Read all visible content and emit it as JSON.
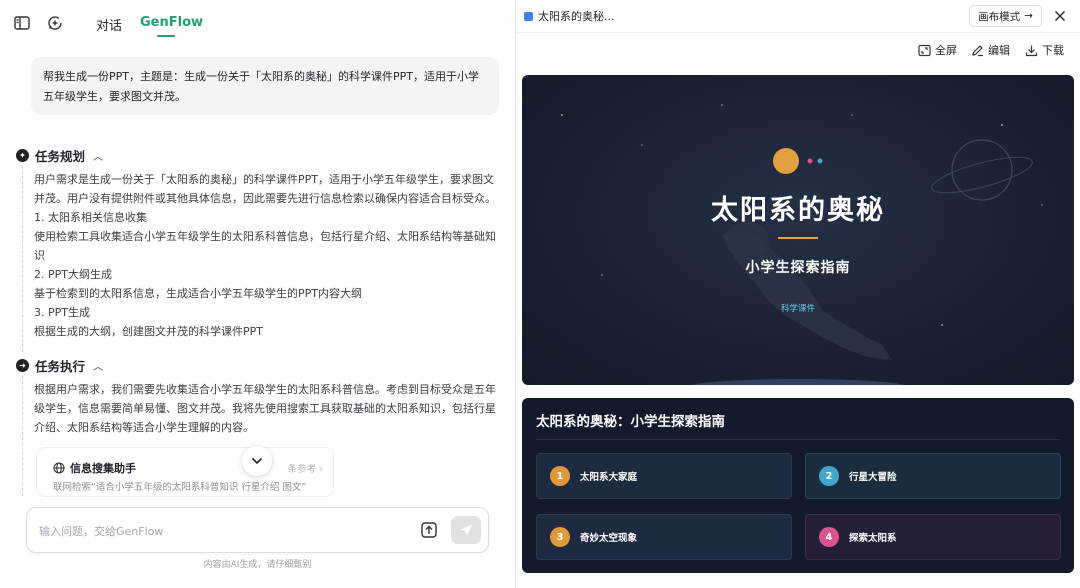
{
  "left": {
    "tabs": [
      "对话",
      "GenFlow"
    ],
    "active_tab": "GenFlow",
    "user_message_line1": "帮我生成一份PPT，主题是：生成一份关于「太阳系的奥秘」的科学课件PPT，适用于小学",
    "user_message_line2": "五年级学生，要求图文并茂。",
    "plan": {
      "title": "任务规划",
      "lines": [
        "用户需求是生成一份关于「太阳系的奥秘」的科学课件PPT，适用于小学五年级学生，要求图文",
        "并茂。用户没有提供附件或其他具体信息，因此需要先进行信息检索以确保内容适合目标受众。",
        "1. 太阳系相关信息收集",
        "使用检索工具收集适合小学五年级学生的太阳系科普信息，包括行星介绍、太阳系结构等基础知",
        "识",
        "2. PPT大纲生成",
        "基于检索到的太阳系信息，生成适合小学五年级学生的PPT内容大纲",
        "3. PPT生成",
        "根据生成的大纲，创建图文并茂的科学课件PPT"
      ]
    },
    "exec": {
      "title": "任务执行",
      "lines": [
        "根据用户需求，我们需要先收集适合小学五年级学生的太阳系科普信息。考虑到目标受众是五年",
        "级学生，信息需要简单易懂、图文并茂。我将先使用搜索工具获取基础的太阳系知识，包括行星",
        "介绍、太阳系结构等适合小学生理解的内容。"
      ]
    },
    "tool_card": {
      "title": "信息搜集助手",
      "desc": "联网检索“适合小学五年级的太阳系科普知识 行星介绍 图文”",
      "ref": "条参考 ›"
    },
    "input": {
      "placeholder": "输入问题，交给GenFlow"
    },
    "footnote": "内容由AI生成，请仔细甄别"
  },
  "right": {
    "doc_title": "太阳系的奥秘...",
    "mode_button": "画布模式",
    "actions": {
      "fullscreen": "全屏",
      "edit": "编辑",
      "download": "下载"
    },
    "slide1": {
      "title": "太阳系的奥秘",
      "subtitle": "小学生探索指南",
      "tag": "科学课件"
    },
    "slide2": {
      "title": "太阳系的奥秘：小学生探索指南",
      "chapters": [
        {
          "num": "1",
          "label": "太阳系大家庭",
          "color": "#e09a3a",
          "bg": "#1e2a3f",
          "border": "#2c3a55"
        },
        {
          "num": "2",
          "label": "行星大冒险",
          "color": "#3fa6cc",
          "bg": "#1a2d3e",
          "border": "#2a4a5c"
        },
        {
          "num": "3",
          "label": "奇妙太空现象",
          "color": "#e09a3a",
          "bg": "#1e2a3f",
          "border": "#2c3a55"
        },
        {
          "num": "4",
          "label": "探索太阳系",
          "color": "#d9558e",
          "bg": "#241f36",
          "border": "#3f2c4a"
        }
      ]
    }
  }
}
